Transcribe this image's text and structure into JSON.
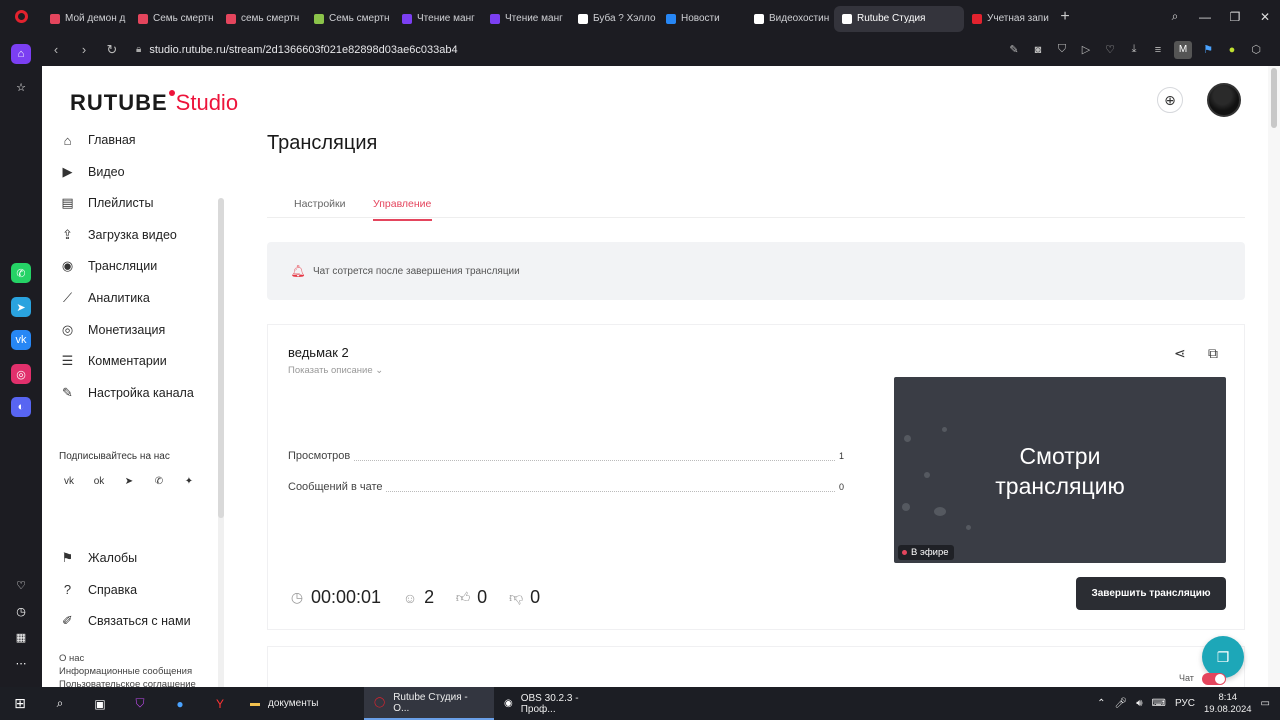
{
  "browser": {
    "tabs": [
      {
        "label": "Мой демон д",
        "color": "#e4455d"
      },
      {
        "label": "Семь смертн",
        "color": "#e4455d"
      },
      {
        "label": "семь смертн",
        "color": "#e4455d"
      },
      {
        "label": "Семь смертн",
        "color": "#8bc34a"
      },
      {
        "label": "Чтение манг",
        "color": "#7b3ff2"
      },
      {
        "label": "Чтение манг",
        "color": "#7b3ff2"
      },
      {
        "label": "Буба ? Хэлло",
        "color": "#ffffff"
      },
      {
        "label": "Новости",
        "color": "#2787f5"
      },
      {
        "label": "Видеохостин",
        "color": "#ffffff"
      },
      {
        "label": "Rutube Студия",
        "color": "#ffffff",
        "active": true
      },
      {
        "label": "Учетная запи",
        "color": "#e2222e"
      }
    ],
    "url": "studio.rutube.ru/stream/2d1366603f021e82898d03ae6c033ab4",
    "profile_letter": "M"
  },
  "header": {
    "logo_main": "RUTUBE",
    "logo_studio": "Studio"
  },
  "sidebar": {
    "items": [
      {
        "label": "Главная",
        "icon": "home-icon",
        "glyph": "⌂"
      },
      {
        "label": "Видео",
        "icon": "video-icon",
        "glyph": "▶"
      },
      {
        "label": "Плейлисты",
        "icon": "playlist-icon",
        "glyph": "▤"
      },
      {
        "label": "Загрузка видео",
        "icon": "upload-icon",
        "glyph": "⇪"
      },
      {
        "label": "Трансляции",
        "icon": "broadcast-icon",
        "glyph": "◉"
      },
      {
        "label": "Аналитика",
        "icon": "analytics-icon",
        "glyph": "⟋"
      },
      {
        "label": "Монетизация",
        "icon": "coin-icon",
        "glyph": "◎"
      },
      {
        "label": "Комментарии",
        "icon": "comments-icon",
        "glyph": "☰"
      },
      {
        "label": "Настройка канала",
        "icon": "wand-icon",
        "glyph": "✎"
      }
    ],
    "subscribe_label": "Подписывайтесь на нас",
    "socials": [
      "vk-icon",
      "ok-icon",
      "telegram-icon",
      "viber-icon",
      "dzen-icon"
    ],
    "bottom_items": [
      {
        "label": "Жалобы",
        "icon": "flag-icon",
        "glyph": "⚑"
      },
      {
        "label": "Справка",
        "icon": "help-icon",
        "glyph": "?"
      },
      {
        "label": "Связаться с нами",
        "icon": "pencil-icon",
        "glyph": "✐"
      }
    ],
    "footer": [
      "О нас",
      "Информационные сообщения",
      "Пользовательское соглашение"
    ]
  },
  "main": {
    "title": "Трансляция",
    "tabs": [
      {
        "label": "Настройки",
        "active": false
      },
      {
        "label": "Управление",
        "active": true
      }
    ],
    "notice": "Чат сотрется после завершения трансляции",
    "stream": {
      "name": "ведьмак 2",
      "show_description": "Показать описание",
      "stats": [
        {
          "label": "Просмотров",
          "value": "1"
        },
        {
          "label": "Сообщений в чате",
          "value": "0"
        }
      ],
      "preview_text_line1": "Смотри",
      "preview_text_line2": "трансляцию",
      "live_label": "В эфире",
      "duration": "00:00:01",
      "viewers": "2",
      "likes": "0",
      "dislikes": "0",
      "end_button": "Завершить трансляцию"
    },
    "chat_label": "Чат"
  },
  "taskbar": {
    "apps": [
      {
        "label": "документы",
        "icon": "folder-icon"
      },
      {
        "label": "Rutube Студия - О...",
        "icon": "opera-icon",
        "active": true
      },
      {
        "label": "OBS 30.2.3 - Проф...",
        "icon": "obs-icon"
      }
    ],
    "lang": "РУС",
    "time": "8:14",
    "date": "19.08.2024"
  },
  "colors": {
    "accent": "#e4455d",
    "brand_red": "#ed143b",
    "dark_button": "#2b2d33",
    "fab": "#1da7b8"
  }
}
